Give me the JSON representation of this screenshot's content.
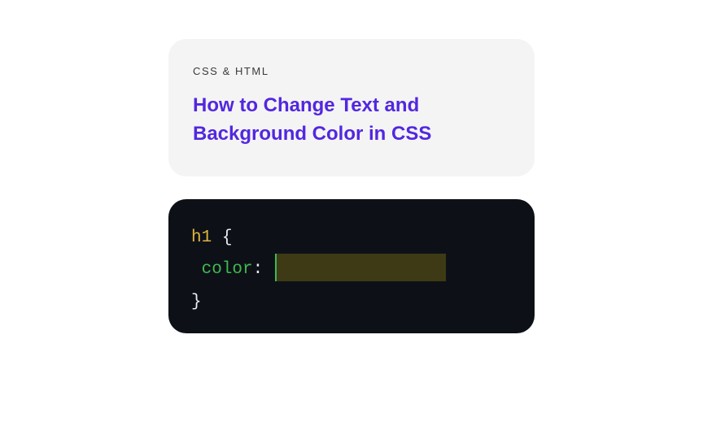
{
  "card": {
    "eyebrow": "CSS & HTML",
    "title": "How to Change Text and Background Color in CSS"
  },
  "code": {
    "selector": "h1",
    "brace_open": "{",
    "property": "color",
    "colon": ":",
    "value": "",
    "brace_close": "}"
  }
}
